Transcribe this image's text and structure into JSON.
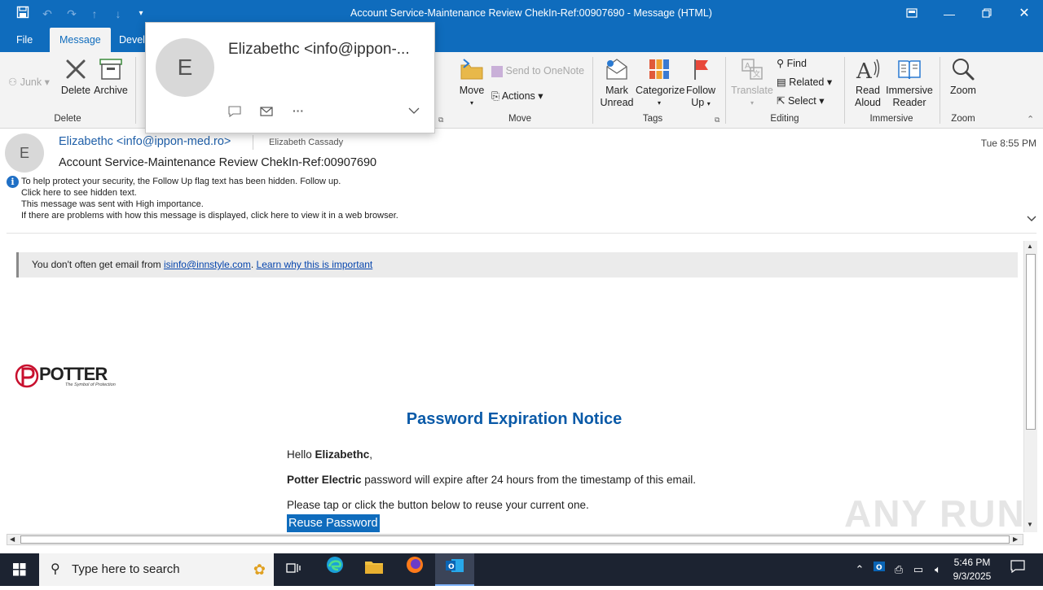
{
  "window": {
    "title": "Account Service-Maintenance Review ChekIn-Ref:00907690  -  Message (HTML)"
  },
  "tabs": [
    "File",
    "Message",
    "Develo"
  ],
  "ribbon": {
    "junk": "Junk",
    "delete": "Delete",
    "archive": "Archive",
    "delete_group": "Delete",
    "move": "Move",
    "send_to_onenote": "Send to OneNote",
    "actions": "Actions",
    "move_group": "Move",
    "mark_unread_1": "Mark",
    "mark_unread_2": "Unread",
    "categorize": "Categorize",
    "follow_up_1": "Follow",
    "follow_up_2": "Up",
    "tags_group": "Tags",
    "translate": "Translate",
    "find": "Find",
    "related": "Related",
    "select": "Select",
    "editing_group": "Editing",
    "read_aloud_1": "Read",
    "read_aloud_2": "Aloud",
    "immersive_1": "Immersive",
    "immersive_2": "Reader",
    "immersive_group": "Immersive",
    "zoom": "Zoom",
    "zoom_group": "Zoom"
  },
  "contact_card": {
    "initial": "E",
    "name": "Elizabethc <info@ippon-..."
  },
  "message": {
    "avatar_initial": "E",
    "sender": "Elizabethc <info@ippon-med.ro>",
    "recipient": "Elizabeth Cassady",
    "date": "Tue 8:55 PM",
    "subject": "Account Service-Maintenance Review ChekIn-Ref:00907690",
    "info_lines": [
      "To help protect your security, the Follow Up flag text has been hidden. Follow up.",
      " Click here to see hidden text.",
      "This message was sent with High importance.",
      "If there are problems with how this message is displayed, click here to view it in a web browser."
    ]
  },
  "body": {
    "warning_prefix": "You don't often get email from ",
    "warning_email": "isinfo@innstyle.com",
    "warning_dot": ". ",
    "warning_link": "Learn why this is important",
    "logo_text": "POTTER",
    "logo_tagline": "The Symbol of Protection",
    "notice_title": "Password Expiration Notice",
    "hello_prefix": "Hello ",
    "hello_name": "Elizabethc",
    "hello_suffix": ",",
    "company": "Potter Electric",
    "expire_text": " password will expire after 24 hours from the timestamp of this email.",
    "instruction": "Please tap or click the button below to reuse your current one.",
    "button": "Reuse Password"
  },
  "watermark": "ANY RUN",
  "taskbar": {
    "search_placeholder": "Type here to search",
    "time": "5:46 PM",
    "date": "9/3/2025"
  },
  "colors": {
    "accent": "#0f6cbd",
    "notice_title": "#0a5aa8",
    "logo_red": "#c8102e"
  }
}
